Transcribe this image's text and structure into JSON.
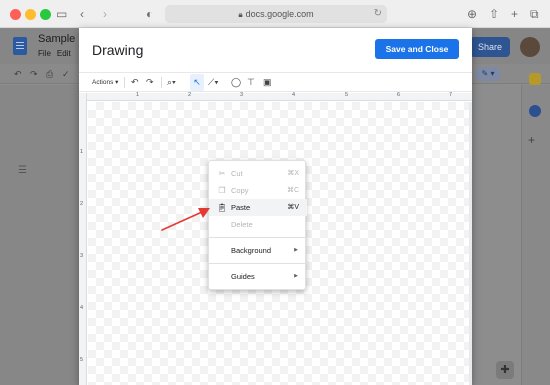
{
  "browser": {
    "address": "docs.google.com",
    "icons": [
      "sidebar-icon",
      "back-icon",
      "forward-icon",
      "shield-icon",
      "lock-icon",
      "reload-icon",
      "download-icon",
      "share-icon",
      "new-tab-icon",
      "tabs-icon"
    ]
  },
  "docs": {
    "title": "Sample D",
    "menu": [
      "File",
      "Edit"
    ],
    "share_label": "Share"
  },
  "drawing": {
    "title": "Drawing",
    "save_label": "Save and Close",
    "toolbar": {
      "actions_label": "Actions",
      "icons": [
        "undo-icon",
        "redo-icon",
        "zoom-icon",
        "select-icon",
        "line-icon",
        "shape-icon",
        "textbox-icon",
        "image-icon"
      ]
    },
    "ruler_numbers": [
      "1",
      "2",
      "3",
      "4",
      "5",
      "6",
      "7"
    ],
    "ruler_left_numbers": [
      "1",
      "2",
      "3",
      "4",
      "5"
    ]
  },
  "context_menu": {
    "items": [
      {
        "label": "Cut",
        "shortcut": "⌘X",
        "icon": "scissors-icon",
        "enabled": false
      },
      {
        "label": "Copy",
        "shortcut": "⌘C",
        "icon": "copy-icon",
        "enabled": false
      },
      {
        "label": "Paste",
        "shortcut": "⌘V",
        "icon": "clipboard-icon",
        "enabled": true
      },
      {
        "label": "Delete",
        "shortcut": "",
        "icon": "",
        "enabled": false
      },
      {
        "label": "Background",
        "submenu": true
      },
      {
        "label": "Guides",
        "submenu": true
      }
    ]
  },
  "colors": {
    "accent": "#1a73e8",
    "annotation_arrow": "#e53935"
  }
}
